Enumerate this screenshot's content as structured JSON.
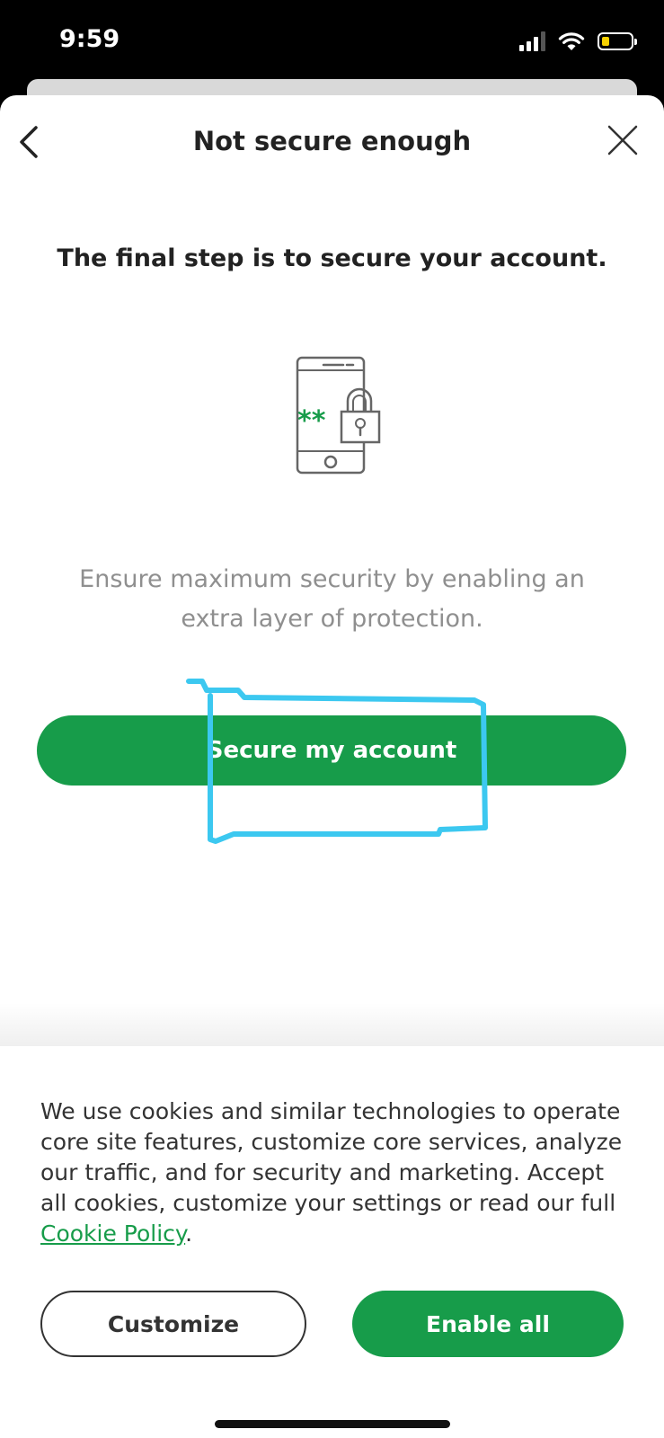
{
  "status_bar": {
    "time": "9:59",
    "signal_icon": "cellular-signal-icon",
    "wifi_icon": "wifi-icon",
    "battery_icon": "battery-low-icon",
    "battery_level": 0.2
  },
  "header": {
    "title": "Not secure enough",
    "back_icon": "chevron-left-icon",
    "close_icon": "close-icon"
  },
  "main": {
    "headline": "The final step is to secure your account.",
    "illustration_icon": "phone-lock-icon",
    "illustration_text": "**",
    "description": "Ensure maximum security by enabling an extra layer of protection.",
    "primary_button": "Secure my account"
  },
  "cookie_banner": {
    "text": "We use cookies and similar technologies to operate core site features, customize core services, analyze our traffic, and for security and marketing. Accept all cookies, customize your settings or read our full ",
    "link": "Cookie Policy",
    "text_end": ".",
    "customize_button": "Customize",
    "enable_button": "Enable all"
  },
  "colors": {
    "brand_green": "#179c4a",
    "annotation_blue": "#3cc8f0",
    "secondary_text": "#8f8f8f"
  }
}
